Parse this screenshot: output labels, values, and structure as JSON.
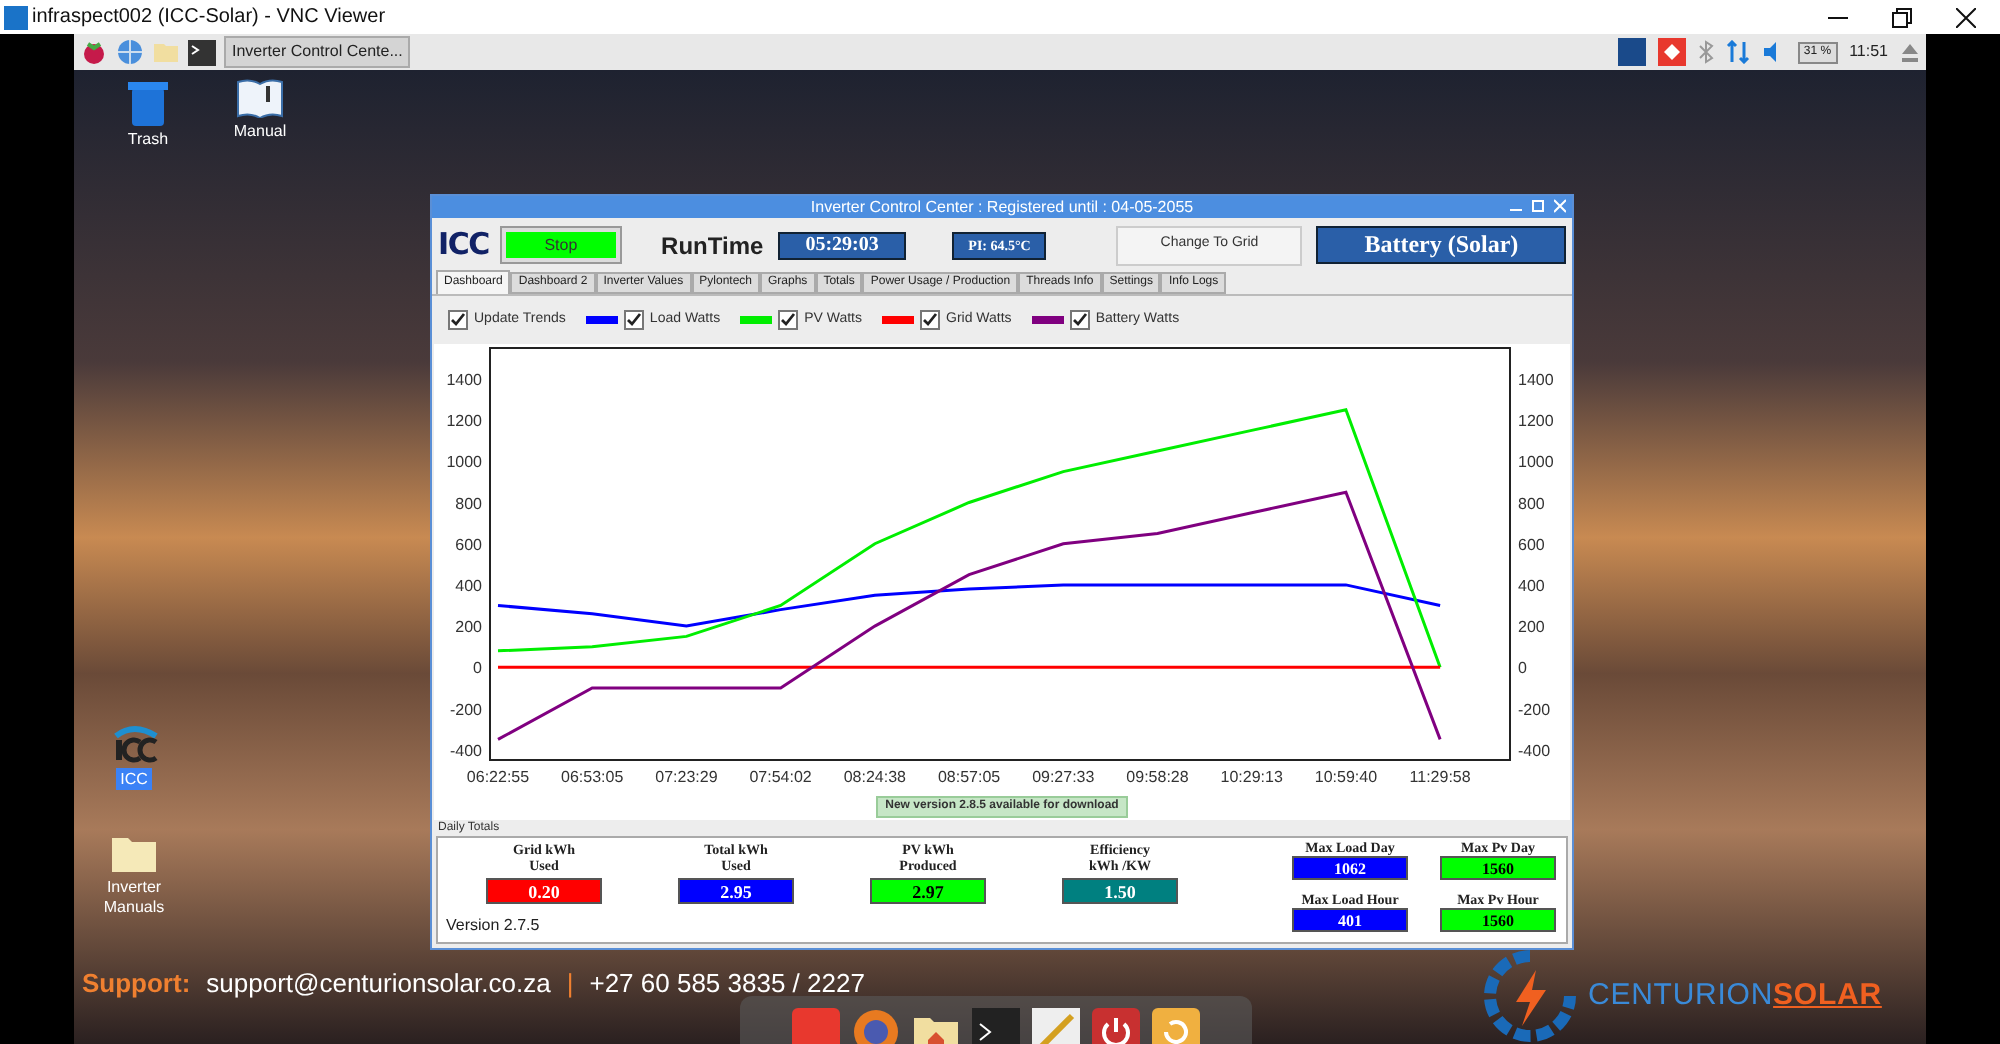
{
  "vnc_window": {
    "title": "infraspect002 (ICC-Solar) - VNC Viewer"
  },
  "taskbar": {
    "task": "Inverter Control Cente...",
    "cpu": "31 %",
    "time": "11:51"
  },
  "desktop_icons": [
    {
      "label": "Trash",
      "kind": "trash"
    },
    {
      "label": "Manual",
      "kind": "book"
    },
    {
      "label": "ICC",
      "kind": "app"
    },
    {
      "label": "Inverter Manuals",
      "kind": "folder"
    }
  ],
  "app": {
    "title": "Inverter Control Center : Registered until : 04-05-2055",
    "logo": "ICC",
    "stop_button": "Stop",
    "runtime_label": "RunTime",
    "runtime": "05:29:03",
    "pi_temp": "PI: 64.5°C",
    "change_button": "Change To Grid",
    "mode": "Battery (Solar)",
    "tabs": [
      {
        "label": "Dashboard",
        "selected": true
      },
      {
        "label": "Dashboard 2",
        "selected": false
      },
      {
        "label": "Inverter Values",
        "selected": false
      },
      {
        "label": "Pylontech",
        "selected": false
      },
      {
        "label": "Graphs",
        "selected": false
      },
      {
        "label": "Totals",
        "selected": false
      },
      {
        "label": "Power Usage / Production",
        "selected": false
      },
      {
        "label": "Threads Info",
        "selected": false
      },
      {
        "label": "Settings",
        "selected": false
      },
      {
        "label": "Info Logs",
        "selected": false
      }
    ],
    "update_trends": {
      "label": "Update Trends",
      "checked": true
    },
    "legend": [
      {
        "checked": true
      },
      {
        "checked": true
      },
      {
        "checked": true
      },
      {
        "checked": true
      }
    ],
    "right_axis_ticks": [
      "1400",
      "1200",
      "1000",
      "800",
      "600",
      "400",
      "200",
      "0",
      "-200",
      "-400"
    ],
    "chart_data": {
      "type": "line",
      "x": [
        "06:22:55",
        "06:53:05",
        "07:23:29",
        "07:54:02",
        "08:24:38",
        "08:57:05",
        "09:27:33",
        "09:58:28",
        "10:29:13",
        "10:59:40",
        "11:29:58"
      ],
      "ylim": [
        -450,
        1550
      ],
      "yticks": [
        -400,
        -200,
        0,
        200,
        400,
        600,
        800,
        1000,
        1200,
        1400
      ],
      "series": [
        {
          "name": "Load Watts",
          "color": "#0000ff",
          "values": [
            300,
            260,
            200,
            280,
            350,
            380,
            400,
            400,
            400,
            400,
            300
          ]
        },
        {
          "name": "PV Watts",
          "color": "#00ee00",
          "values": [
            80,
            100,
            150,
            300,
            600,
            800,
            950,
            1050,
            1150,
            1250,
            0
          ]
        },
        {
          "name": "Grid Watts",
          "color": "#ff0000",
          "values": [
            0,
            0,
            0,
            0,
            0,
            0,
            0,
            0,
            0,
            0,
            0
          ]
        },
        {
          "name": "Battery Watts",
          "color": "#800080",
          "values": [
            -350,
            -100,
            -100,
            -100,
            200,
            450,
            600,
            650,
            750,
            850,
            -350
          ]
        }
      ]
    },
    "update_notice": "New version 2.8.5 available for download",
    "daily_totals": {
      "title": "Daily Totals",
      "stats": [
        {
          "label": "Grid kWh\nUsed",
          "value": "0.20",
          "color": "#ff0000"
        },
        {
          "label": "Total kWh\nUsed",
          "value": "2.95",
          "color": "#0000ff"
        },
        {
          "label": "PV kWh\nProduced",
          "value": "2.97",
          "color": "#00ff00"
        },
        {
          "label": "Efficiency\nkWh /KW",
          "value": "1.50",
          "color": "#008080"
        }
      ],
      "max": [
        {
          "label": "Max Load Day",
          "value": "1062",
          "color": "#0000ff"
        },
        {
          "label": "Max Pv Day",
          "value": "1560",
          "color": "#00ff00"
        },
        {
          "label": "Max Load Hour",
          "value": "401",
          "color": "#0000ff"
        },
        {
          "label": "Max Pv Hour",
          "value": "1560",
          "color": "#00ff00"
        }
      ],
      "version": "Version 2.7.5"
    }
  },
  "support": {
    "label": "Support:",
    "email": "support@centurionsolar.co.za",
    "separator": "|",
    "phone": "+27 60 585 3835 / 2227"
  },
  "brand": {
    "name": "CENTURION",
    "accent": "SOLAR"
  }
}
